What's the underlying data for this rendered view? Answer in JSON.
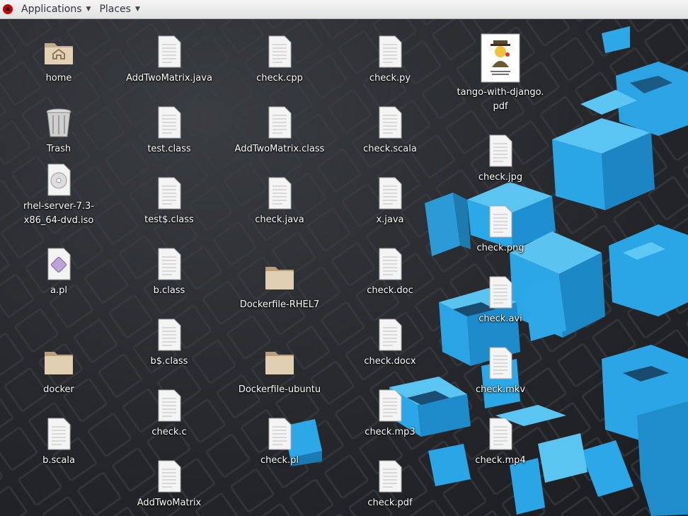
{
  "topbar": {
    "applications_label": "Applications",
    "places_label": "Places"
  },
  "desktop": {
    "home": "home",
    "trash": "Trash",
    "rhel_iso": "rhel-server-7.3-\nx86_64-dvd.iso",
    "a_pl": "a.pl",
    "docker": "docker",
    "b_scala": "b.scala",
    "addtwomatrix_java": "AddTwoMatrix.java",
    "test_class": "test.class",
    "test_dollar_class": "test$.class",
    "b_class": "b.class",
    "b_dollar_class": "b$.class",
    "check_c": "check.c",
    "addtwomatrix": "AddTwoMatrix",
    "check_cpp": "check.cpp",
    "addtwomatrix_class": "AddTwoMatrix.class",
    "check_java": "check.java",
    "dockerfile_rhel7": "Dockerfile-RHEL7",
    "dockerfile_ubuntu": "Dockerfile-ubuntu",
    "check_pl": "check.pl",
    "check_py": "check.py",
    "check_scala": "check.scala",
    "x_java": "x.java",
    "check_doc": "check.doc",
    "check_docx": "check.docx",
    "check_mp3": "check.mp3",
    "check_pdf": "check.pdf",
    "tango_pdf": "tango-with-django.\npdf",
    "check_jpg": "check.jpg",
    "check_png": "check.png",
    "check_avi": "check.avi",
    "check_mkv": "check.mkv",
    "check_mp4": "check.mp4"
  },
  "colors": {
    "accent_blue": "#29a3e0",
    "desktop_dark": "#26282c"
  }
}
